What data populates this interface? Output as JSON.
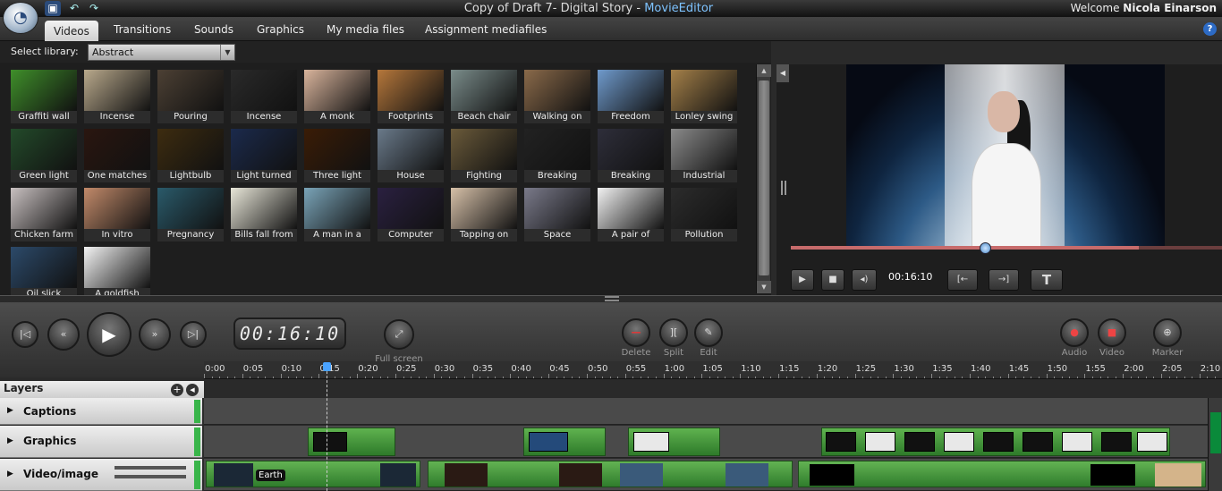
{
  "titlebar": {
    "title_prefix": "Copy of Draft 7- Digital Story - ",
    "title_app": "MovieEditor",
    "welcome_prefix": "Welcome ",
    "user": "Nicola  Einarson"
  },
  "tabs": [
    "Videos",
    "Transitions",
    "Sounds",
    "Graphics",
    "My media files",
    "Assignment mediafiles"
  ],
  "active_tab": "Videos",
  "library": {
    "label": "Select library:",
    "selected": "Abstract",
    "clips": [
      {
        "label": "Graffiti wall",
        "color": "#3f8f2a"
      },
      {
        "label": "Incense",
        "color": "#b9a98c"
      },
      {
        "label": "Pouring",
        "color": "#4c4034"
      },
      {
        "label": "Incense",
        "color": "#2a2a2a"
      },
      {
        "label": "A monk",
        "color": "#d9b49c"
      },
      {
        "label": "Footprints",
        "color": "#b5773b"
      },
      {
        "label": "Beach chair",
        "color": "#7a8c8a"
      },
      {
        "label": "Walking on",
        "color": "#8a6a4a"
      },
      {
        "label": "Freedom",
        "color": "#6f9acc"
      },
      {
        "label": "Lonley swing",
        "color": "#a48049"
      },
      {
        "label": "Green light",
        "color": "#234a2a"
      },
      {
        "label": "One matches",
        "color": "#2a1610"
      },
      {
        "label": "Lightbulb",
        "color": "#3d2c10"
      },
      {
        "label": "Light turned",
        "color": "#1b2a4c"
      },
      {
        "label": "Three light",
        "color": "#3a1c06"
      },
      {
        "label": "House",
        "color": "#6a7a8a"
      },
      {
        "label": "Fighting",
        "color": "#6a5a3a"
      },
      {
        "label": "Breaking",
        "color": "#222222"
      },
      {
        "label": "Breaking",
        "color": "#2e2e3a"
      },
      {
        "label": "Industrial",
        "color": "#8a8a8a"
      },
      {
        "label": "Chicken farm",
        "color": "#c8c0c0"
      },
      {
        "label": "In vitro",
        "color": "#c28a6a"
      },
      {
        "label": "Pregnancy",
        "color": "#2a5a6a"
      },
      {
        "label": "Bills fall from",
        "color": "#e8e6d8"
      },
      {
        "label": "A man in a",
        "color": "#7aa4b8"
      },
      {
        "label": "Computer",
        "color": "#2a2040"
      },
      {
        "label": "Tapping on",
        "color": "#d6c0a8"
      },
      {
        "label": "Space",
        "color": "#7a7a8a"
      },
      {
        "label": "A pair of",
        "color": "#f2f2f2"
      },
      {
        "label": "Pollution",
        "color": "#2c2c2c"
      },
      {
        "label": "Oil slick",
        "color": "#2c4a6a"
      },
      {
        "label": "A goldfish",
        "color": "#f4f4f4"
      }
    ]
  },
  "preview": {
    "time": "00:16:10",
    "progress_fraction": 0.45
  },
  "transport": {
    "timecode": "00:16:10",
    "fullscreen_label": "Full screen",
    "delete_label": "Delete",
    "split_label": "Split",
    "edit_label": "Edit",
    "audio_label": "Audio",
    "video_label": "Video",
    "marker_label": "Marker"
  },
  "ruler": [
    "0:00",
    "0:05",
    "0:10",
    "0:15",
    "0:20",
    "0:25",
    "0:30",
    "0:35",
    "0:40",
    "0:45",
    "0:50",
    "0:55",
    "1:00",
    "1:05",
    "1:10",
    "1:15",
    "1:20",
    "1:25",
    "1:30",
    "1:35",
    "1:40",
    "1:45",
    "1:50",
    "1:55",
    "2:00",
    "2:05",
    "2:10"
  ],
  "layers": {
    "header": "Layers",
    "items": [
      {
        "name": "Captions"
      },
      {
        "name": "Graphics"
      },
      {
        "name": "Video/image"
      }
    ],
    "video_clip_label": "Earth"
  },
  "colors": {
    "accent": "#7ec3ff",
    "track_green": "#39b54a",
    "progress": "#c76b6b"
  }
}
